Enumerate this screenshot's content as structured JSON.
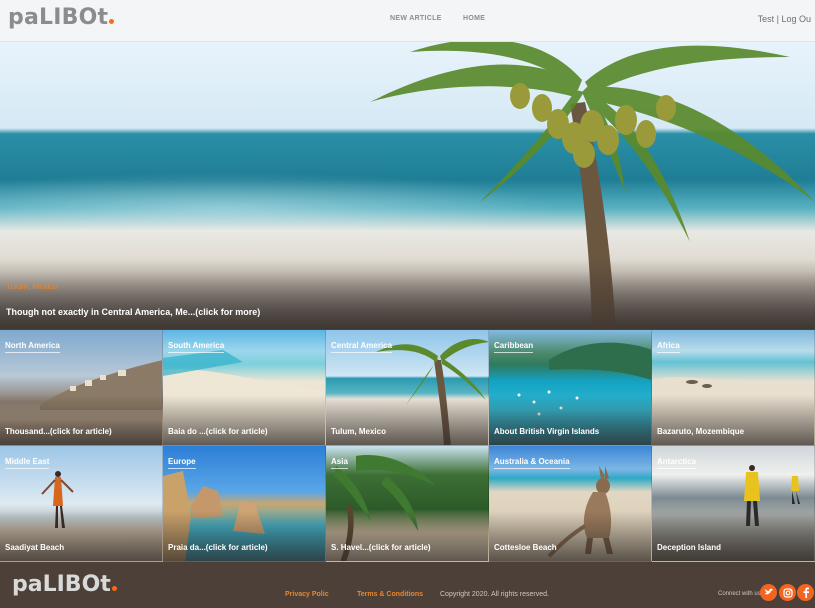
{
  "header": {
    "logo": "paLIBOt",
    "nav": [
      "NEW ARTICLE",
      "HOME"
    ],
    "user": "Test",
    "separator": "|",
    "logout": "Log Ou"
  },
  "hero": {
    "tag": "Tulum, Mexico",
    "caption": "Though not exactly in Central America, Me...(click for more)"
  },
  "tiles": [
    {
      "region": "North America",
      "caption": "Thousand...(click for article)"
    },
    {
      "region": "South America",
      "caption": "Baia do ...(click for article)"
    },
    {
      "region": "Central America",
      "caption": "Tulum, Mexico"
    },
    {
      "region": "Caribbean",
      "caption": "About British Virgin Islands"
    },
    {
      "region": "Africa",
      "caption": "Bazaruto, Mozembique"
    },
    {
      "region": "Middle East",
      "caption": "Saadiyat Beach"
    },
    {
      "region": "Europe",
      "caption": "Praia da...(click for article)"
    },
    {
      "region": "Asia",
      "caption": "S. Havel...(click for article)"
    },
    {
      "region": "Australia & Oceania",
      "caption": "Cottesloe Beach"
    },
    {
      "region": "Antarctica",
      "caption": "Deception Island"
    }
  ],
  "footer": {
    "logo": "paLIBOt",
    "privacy": "Privacy Polic",
    "terms": "Terms & Conditions",
    "copyright": "Copyright 2020. All rights reserved.",
    "connect": "Connect with us",
    "social_icons": [
      "twitter-icon",
      "instagram-icon",
      "facebook-icon"
    ]
  },
  "colors": {
    "accent": "#f26522",
    "footer_bg": "#4c4038",
    "header_bg": "#f4f5f6"
  }
}
